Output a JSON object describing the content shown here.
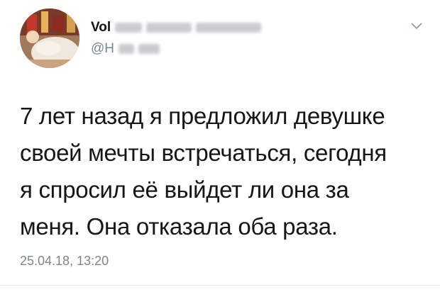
{
  "user": {
    "display_name_visible": "Vol",
    "handle_visible": "@H"
  },
  "tweet": {
    "lines": [
      "7 лет назад я предложил девушке",
      "своей мечты встречаться, сегодня",
      "я спросил её выйдет ли она за",
      "меня. Она отказала оба раза."
    ],
    "timestamp": "25.04.18, 13:20"
  },
  "icons": {
    "menu": "chevron-down-icon"
  },
  "colors": {
    "secondary_text": "#7a8791",
    "primary_text": "#161616"
  }
}
